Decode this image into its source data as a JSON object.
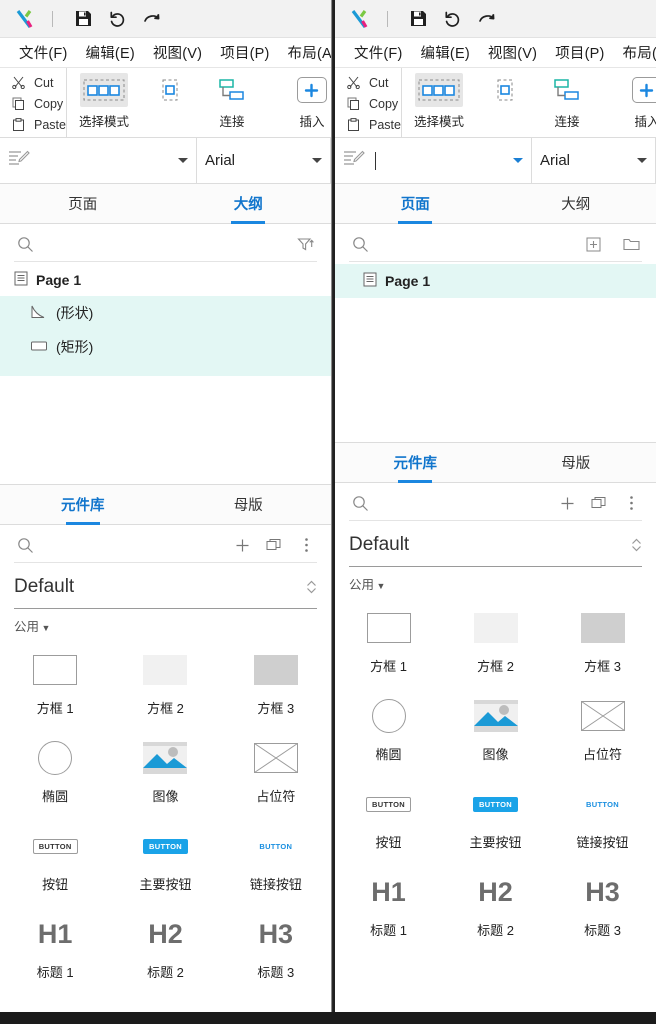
{
  "app": {
    "title_icons": [
      "axure-logo",
      "save-icon",
      "undo-icon",
      "redo-icon"
    ]
  },
  "menubar": {
    "items": [
      {
        "label": "文件(F)",
        "text": "文件",
        "accel": "F"
      },
      {
        "label": "编辑(E)",
        "text": "编辑",
        "accel": "E"
      },
      {
        "label": "视图(V)",
        "text": "视图",
        "accel": "V"
      },
      {
        "label": "项目(P)",
        "text": "项目",
        "accel": "P"
      },
      {
        "label": "布局(A",
        "text": "布局",
        "accel": "A"
      }
    ]
  },
  "ribbon": {
    "clipboard": [
      {
        "label": "Cut",
        "icon": "scissors-icon"
      },
      {
        "label": "Copy",
        "icon": "copy-icon"
      },
      {
        "label": "Paste",
        "icon": "clipboard-icon"
      }
    ],
    "tools": [
      {
        "label": "选择模式",
        "icon": "selection-mode-icon",
        "active": true
      },
      {
        "label": "连接",
        "icon": "connector-icon",
        "active": false
      },
      {
        "label": "插入",
        "icon": "insert-plus-icon",
        "active": false
      }
    ]
  },
  "stylebar": {
    "style_value": "",
    "style_icon": "text-style-icon",
    "font_value": "Arial"
  },
  "outline_panel": {
    "tabs": [
      {
        "label": "页面",
        "active_left": false,
        "active_right": true
      },
      {
        "label": "大纲",
        "active_left": true,
        "active_right": false
      }
    ],
    "search_placeholder": "",
    "left_toolbar_icons": [
      "search-icon",
      "filter-sort-icon"
    ],
    "right_toolbar_icons": [
      "search-icon",
      "add-page-icon",
      "add-folder-icon"
    ],
    "left_tree": [
      {
        "label": "Page 1",
        "icon": "page-icon",
        "level": 0,
        "bold": true,
        "selected": false
      },
      {
        "label": "(形状)",
        "icon": "shape-icon",
        "level": 1,
        "bold": false,
        "selected": true
      },
      {
        "label": "(矩形)",
        "icon": "rectangle-icon",
        "level": 1,
        "bold": false,
        "selected": true
      }
    ],
    "right_tree": [
      {
        "label": "Page 1",
        "icon": "page-icon",
        "level": 0,
        "bold": true,
        "selected": true
      }
    ]
  },
  "library_panel": {
    "tabs": [
      {
        "label": "元件库",
        "active": true
      },
      {
        "label": "母版",
        "active": false
      }
    ],
    "toolbar_icons": [
      "search-icon",
      "plus-icon",
      "panes-icon",
      "more-vertical-icon"
    ],
    "selected_library": "Default",
    "group_label": "公用",
    "widgets": [
      {
        "label": "方框 1",
        "art": "box1"
      },
      {
        "label": "方框 2",
        "art": "box2"
      },
      {
        "label": "方框 3",
        "art": "box3"
      },
      {
        "label": "椭圆",
        "art": "ellipse"
      },
      {
        "label": "图像",
        "art": "image"
      },
      {
        "label": "占位符",
        "art": "placeholder"
      },
      {
        "label": "按钮",
        "art": "button",
        "art_text": "BUTTON"
      },
      {
        "label": "主要按钮",
        "art": "button-primary",
        "art_text": "BUTTON"
      },
      {
        "label": "链接按钮",
        "art": "button-link",
        "art_text": "BUTTON"
      },
      {
        "label": "标题 1",
        "art": "heading",
        "art_text": "H1"
      },
      {
        "label": "标题 2",
        "art": "heading",
        "art_text": "H2"
      },
      {
        "label": "标题 3",
        "art": "heading",
        "art_text": "H3"
      }
    ]
  },
  "colors": {
    "accent": "#1b87e0",
    "tab_active_text": "#1175cc",
    "selection": "#e3f7f4",
    "primary_button": "#1aa3e8",
    "image_blue": "#1b9ad6",
    "logo_blue": "#1b9ad6",
    "logo_green": "#7ac943",
    "logo_pink": "#e8217f"
  }
}
